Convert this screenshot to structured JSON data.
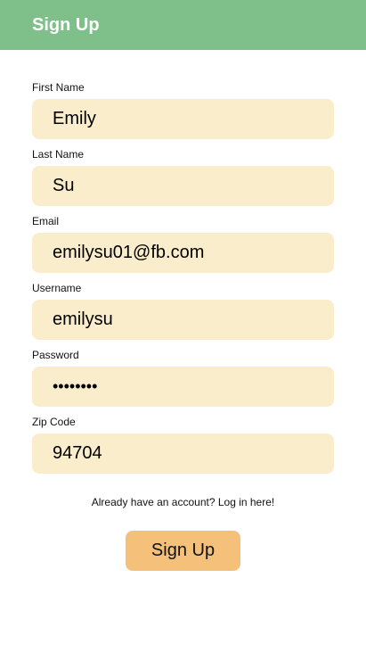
{
  "header": {
    "title": "Sign Up"
  },
  "form": {
    "first_name": {
      "label": "First Name",
      "value": "Emily"
    },
    "last_name": {
      "label": "Last Name",
      "value": "Su"
    },
    "email": {
      "label": "Email",
      "value": "emilysu01@fb.com"
    },
    "username": {
      "label": "Username",
      "value": "emilysu"
    },
    "password": {
      "label": "Password",
      "value": "••••••••"
    },
    "zip_code": {
      "label": "Zip Code",
      "value": "94704"
    }
  },
  "login_link": "Already have an account? Log in here!",
  "submit_label": "Sign Up",
  "colors": {
    "header_bg": "#7fbf8a",
    "field_bg": "#faedcb",
    "button_bg": "#f4c07a"
  }
}
